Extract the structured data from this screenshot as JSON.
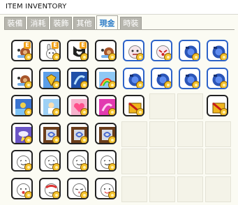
{
  "window": {
    "title": "ITEM INVENTORY"
  },
  "tabs": [
    {
      "label": "裝備",
      "active": false
    },
    {
      "label": "消耗",
      "active": false
    },
    {
      "label": "裝飾",
      "active": false
    },
    {
      "label": "其他",
      "active": false
    },
    {
      "label": "現金",
      "active": true
    },
    {
      "label": "時裝",
      "active": false
    }
  ],
  "inventory": {
    "columns": 8,
    "rows": 6,
    "slots": [
      {
        "icon": "snail-pet-icon",
        "e": true
      },
      {
        "icon": "rabbit-pet-icon",
        "e": true
      },
      {
        "icon": "husky-pet-icon",
        "e": true
      },
      {
        "icon": "snail-pet-icon",
        "e": false
      },
      {
        "icon": "face-mask-icon",
        "e": false
      },
      {
        "icon": "face-mask-red-icon",
        "e": false
      },
      {
        "icon": "blue-megaphone-icon",
        "e": false
      },
      {
        "icon": "blue-megaphone-icon",
        "e": false
      },
      {
        "icon": "snail-pet-icon",
        "e": false
      },
      {
        "icon": "gold-shield-scroll-icon",
        "e": false
      },
      {
        "icon": "blue-swirl-scroll-icon",
        "e": false
      },
      {
        "icon": "rainbow-scroll-icon",
        "e": false
      },
      {
        "icon": "blue-megaphone-icon",
        "e": false
      },
      {
        "icon": "blue-megaphone-icon",
        "e": false
      },
      {
        "icon": "blue-megaphone-icon",
        "e": false
      },
      {
        "icon": "blue-megaphone-icon",
        "e": false
      },
      {
        "icon": "water-scroll-icon",
        "e": false
      },
      {
        "icon": "angel-scroll-icon",
        "e": false
      },
      {
        "icon": "heart-scroll-icon",
        "e": false
      },
      {
        "icon": "pink-swirl-scroll-icon",
        "e": false
      },
      {
        "icon": "red-gift-box-icon",
        "e": false
      },
      null,
      null,
      {
        "icon": "red-gift-box-icon",
        "e": false
      },
      {
        "icon": "purple-cloud-scroll-icon",
        "e": false
      },
      {
        "icon": "portal-frame-icon",
        "e": false
      },
      {
        "icon": "portal-frame-icon",
        "e": false
      },
      {
        "icon": "portal-frame-icon",
        "e": false
      },
      null,
      null,
      null,
      null,
      {
        "icon": "smiley-face-icon",
        "e": false
      },
      {
        "icon": "smiley-face-icon",
        "e": false
      },
      {
        "icon": "smiley-face-icon",
        "e": false
      },
      {
        "icon": "smiley-face-icon",
        "e": false
      },
      null,
      null,
      null,
      null,
      {
        "icon": "surprised-face-icon",
        "e": false
      },
      {
        "icon": "red-mask-face-icon",
        "e": false
      },
      {
        "icon": "squint-face-icon",
        "e": false
      },
      {
        "icon": "smile-face-icon",
        "e": false
      },
      null,
      null,
      null,
      null
    ]
  },
  "colors": {
    "tab_active_text": "#2c7cc7",
    "tab_inactive_bg": "#b7b6ae",
    "coin": "#f4c22b",
    "empty_slot": "#f4f3e8"
  }
}
